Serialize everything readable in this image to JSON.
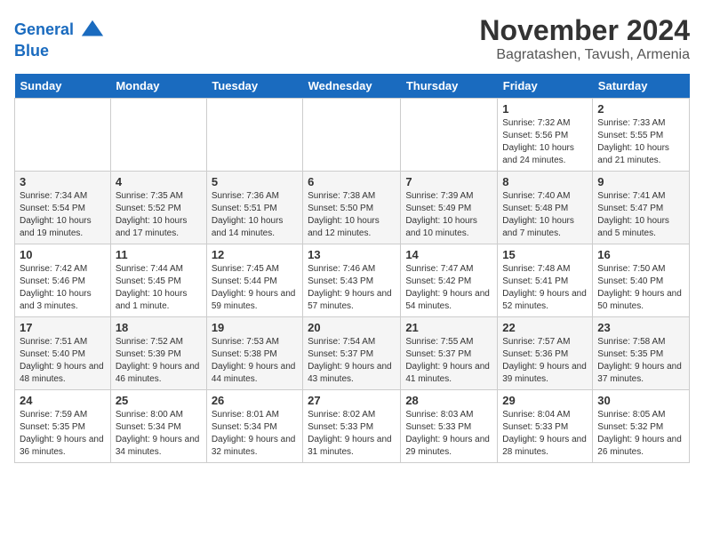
{
  "header": {
    "logo_line1": "General",
    "logo_line2": "Blue",
    "month": "November 2024",
    "location": "Bagratashen, Tavush, Armenia"
  },
  "days_of_week": [
    "Sunday",
    "Monday",
    "Tuesday",
    "Wednesday",
    "Thursday",
    "Friday",
    "Saturday"
  ],
  "weeks": [
    [
      {
        "day": "",
        "info": ""
      },
      {
        "day": "",
        "info": ""
      },
      {
        "day": "",
        "info": ""
      },
      {
        "day": "",
        "info": ""
      },
      {
        "day": "",
        "info": ""
      },
      {
        "day": "1",
        "info": "Sunrise: 7:32 AM\nSunset: 5:56 PM\nDaylight: 10 hours and 24 minutes."
      },
      {
        "day": "2",
        "info": "Sunrise: 7:33 AM\nSunset: 5:55 PM\nDaylight: 10 hours and 21 minutes."
      }
    ],
    [
      {
        "day": "3",
        "info": "Sunrise: 7:34 AM\nSunset: 5:54 PM\nDaylight: 10 hours and 19 minutes."
      },
      {
        "day": "4",
        "info": "Sunrise: 7:35 AM\nSunset: 5:52 PM\nDaylight: 10 hours and 17 minutes."
      },
      {
        "day": "5",
        "info": "Sunrise: 7:36 AM\nSunset: 5:51 PM\nDaylight: 10 hours and 14 minutes."
      },
      {
        "day": "6",
        "info": "Sunrise: 7:38 AM\nSunset: 5:50 PM\nDaylight: 10 hours and 12 minutes."
      },
      {
        "day": "7",
        "info": "Sunrise: 7:39 AM\nSunset: 5:49 PM\nDaylight: 10 hours and 10 minutes."
      },
      {
        "day": "8",
        "info": "Sunrise: 7:40 AM\nSunset: 5:48 PM\nDaylight: 10 hours and 7 minutes."
      },
      {
        "day": "9",
        "info": "Sunrise: 7:41 AM\nSunset: 5:47 PM\nDaylight: 10 hours and 5 minutes."
      }
    ],
    [
      {
        "day": "10",
        "info": "Sunrise: 7:42 AM\nSunset: 5:46 PM\nDaylight: 10 hours and 3 minutes."
      },
      {
        "day": "11",
        "info": "Sunrise: 7:44 AM\nSunset: 5:45 PM\nDaylight: 10 hours and 1 minute."
      },
      {
        "day": "12",
        "info": "Sunrise: 7:45 AM\nSunset: 5:44 PM\nDaylight: 9 hours and 59 minutes."
      },
      {
        "day": "13",
        "info": "Sunrise: 7:46 AM\nSunset: 5:43 PM\nDaylight: 9 hours and 57 minutes."
      },
      {
        "day": "14",
        "info": "Sunrise: 7:47 AM\nSunset: 5:42 PM\nDaylight: 9 hours and 54 minutes."
      },
      {
        "day": "15",
        "info": "Sunrise: 7:48 AM\nSunset: 5:41 PM\nDaylight: 9 hours and 52 minutes."
      },
      {
        "day": "16",
        "info": "Sunrise: 7:50 AM\nSunset: 5:40 PM\nDaylight: 9 hours and 50 minutes."
      }
    ],
    [
      {
        "day": "17",
        "info": "Sunrise: 7:51 AM\nSunset: 5:40 PM\nDaylight: 9 hours and 48 minutes."
      },
      {
        "day": "18",
        "info": "Sunrise: 7:52 AM\nSunset: 5:39 PM\nDaylight: 9 hours and 46 minutes."
      },
      {
        "day": "19",
        "info": "Sunrise: 7:53 AM\nSunset: 5:38 PM\nDaylight: 9 hours and 44 minutes."
      },
      {
        "day": "20",
        "info": "Sunrise: 7:54 AM\nSunset: 5:37 PM\nDaylight: 9 hours and 43 minutes."
      },
      {
        "day": "21",
        "info": "Sunrise: 7:55 AM\nSunset: 5:37 PM\nDaylight: 9 hours and 41 minutes."
      },
      {
        "day": "22",
        "info": "Sunrise: 7:57 AM\nSunset: 5:36 PM\nDaylight: 9 hours and 39 minutes."
      },
      {
        "day": "23",
        "info": "Sunrise: 7:58 AM\nSunset: 5:35 PM\nDaylight: 9 hours and 37 minutes."
      }
    ],
    [
      {
        "day": "24",
        "info": "Sunrise: 7:59 AM\nSunset: 5:35 PM\nDaylight: 9 hours and 36 minutes."
      },
      {
        "day": "25",
        "info": "Sunrise: 8:00 AM\nSunset: 5:34 PM\nDaylight: 9 hours and 34 minutes."
      },
      {
        "day": "26",
        "info": "Sunrise: 8:01 AM\nSunset: 5:34 PM\nDaylight: 9 hours and 32 minutes."
      },
      {
        "day": "27",
        "info": "Sunrise: 8:02 AM\nSunset: 5:33 PM\nDaylight: 9 hours and 31 minutes."
      },
      {
        "day": "28",
        "info": "Sunrise: 8:03 AM\nSunset: 5:33 PM\nDaylight: 9 hours and 29 minutes."
      },
      {
        "day": "29",
        "info": "Sunrise: 8:04 AM\nSunset: 5:33 PM\nDaylight: 9 hours and 28 minutes."
      },
      {
        "day": "30",
        "info": "Sunrise: 8:05 AM\nSunset: 5:32 PM\nDaylight: 9 hours and 26 minutes."
      }
    ]
  ]
}
